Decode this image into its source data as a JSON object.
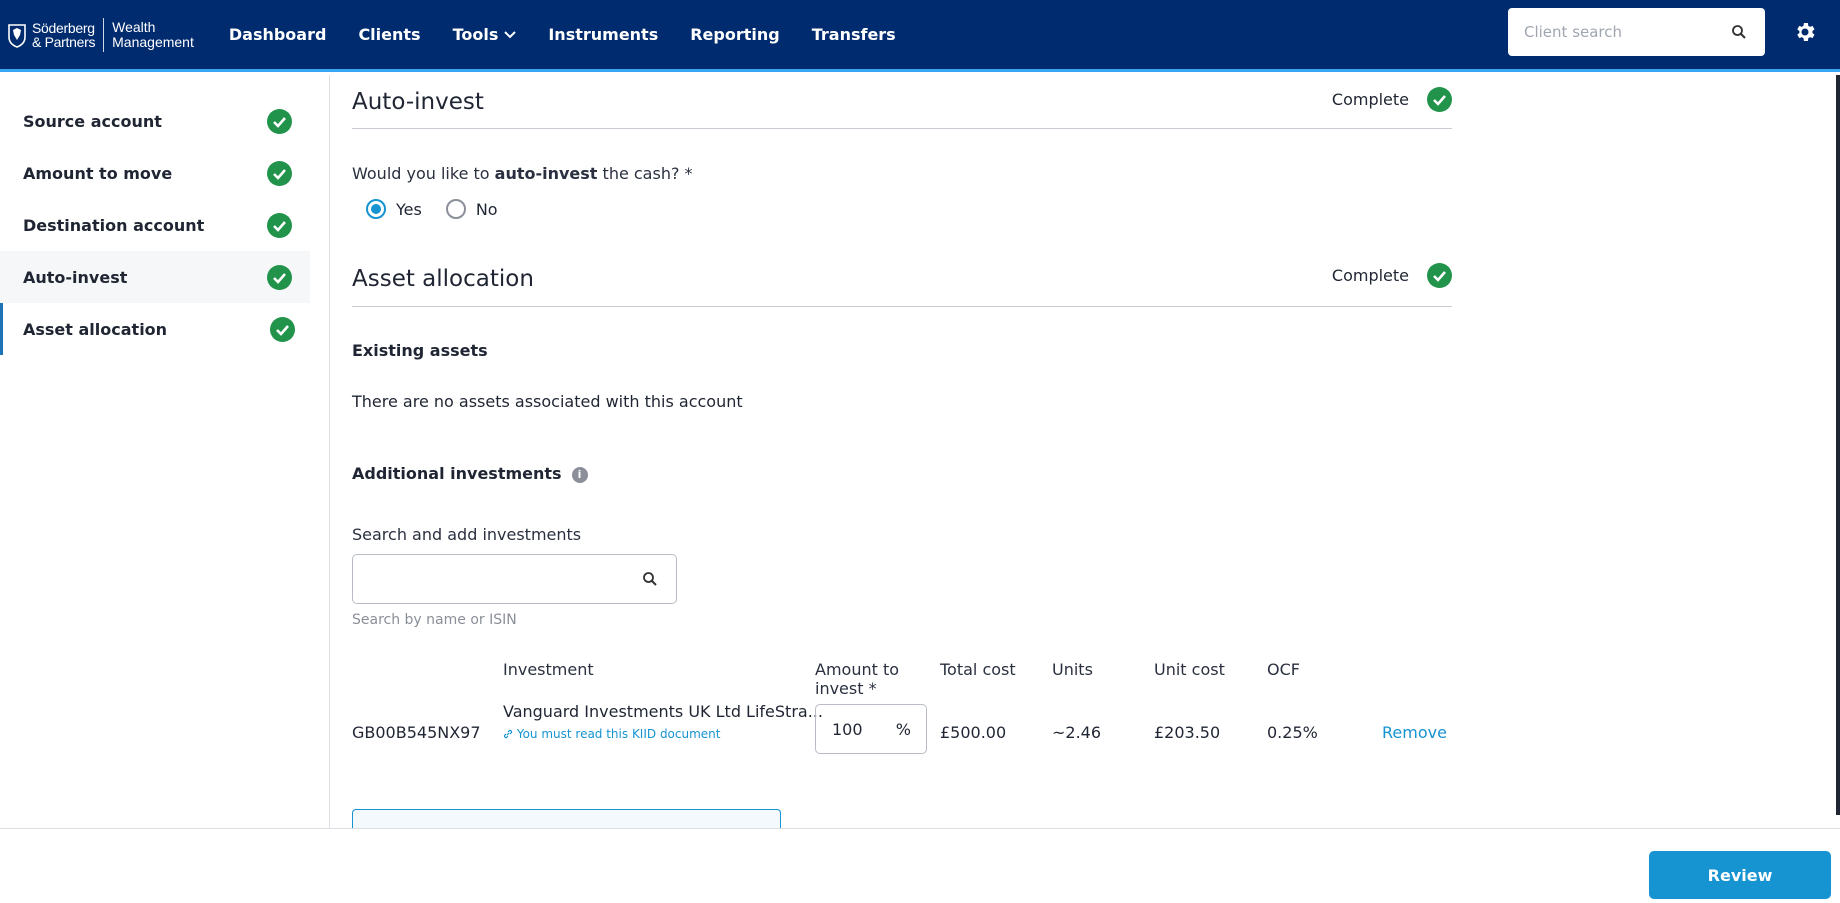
{
  "brand": {
    "name_line1": "Söderberg",
    "name_line2": "& Partners",
    "sub_line1": "Wealth",
    "sub_line2": "Management"
  },
  "nav": {
    "items": [
      "Dashboard",
      "Clients",
      "Tools",
      "Instruments",
      "Reporting",
      "Transfers"
    ]
  },
  "header": {
    "client_search_placeholder": "Client search"
  },
  "sidebar": {
    "items": [
      {
        "label": "Source account"
      },
      {
        "label": "Amount to move"
      },
      {
        "label": "Destination account"
      },
      {
        "label": "Auto-invest"
      },
      {
        "label": "Asset allocation"
      }
    ]
  },
  "auto_invest": {
    "title": "Auto-invest",
    "status": "Complete",
    "question_prefix": "Would you like to ",
    "question_bold": "auto-invest",
    "question_suffix": " the cash? *",
    "options": [
      "Yes",
      "No"
    ],
    "selected": "Yes"
  },
  "asset_allocation": {
    "title": "Asset allocation",
    "status": "Complete",
    "existing_heading": "Existing assets",
    "existing_empty": "There are no assets associated with this account",
    "additional_heading": "Additional investments",
    "search_label": "Search and add investments",
    "search_hint": "Search by name or ISIN",
    "columns": {
      "investment": "Investment",
      "amount_line1": "Amount to",
      "amount_line2": "invest *",
      "total_cost": "Total cost",
      "units": "Units",
      "unit_cost": "Unit cost",
      "ocf": "OCF"
    },
    "row": {
      "isin": "GB00B545NX97",
      "name": "Vanguard Investments UK Ltd LifeStra...",
      "kiid": "You must read this KIID document",
      "amount": "100",
      "amount_unit": "%",
      "total_cost": "£500.00",
      "units": "~2.46",
      "unit_cost": "£203.50",
      "ocf": "0.25%",
      "remove": "Remove"
    }
  },
  "footer": {
    "review": "Review"
  },
  "colors": {
    "header_bg": "#002b6e",
    "accent": "#1693d1",
    "success": "#21934a"
  }
}
